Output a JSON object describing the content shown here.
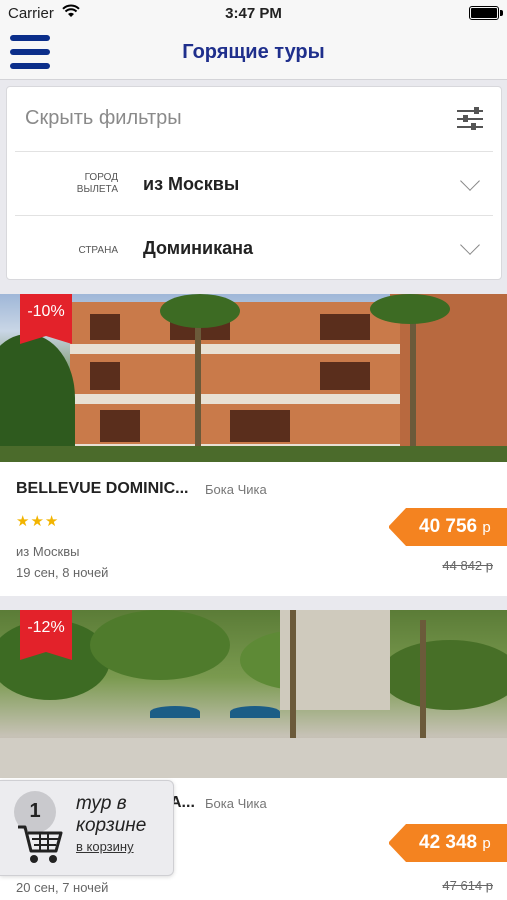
{
  "status_bar": {
    "carrier": "Carrier",
    "time": "3:47 PM"
  },
  "header": {
    "title": "Горящие туры"
  },
  "filters": {
    "hide_label": "Скрыть фильтры",
    "rows": [
      {
        "label": "Город вылета",
        "value": "из Москвы"
      },
      {
        "label": "Страна",
        "value": "Доминикана"
      }
    ]
  },
  "tours": [
    {
      "discount": "-10%",
      "hotel": "BELLEVUE DOMINIC...",
      "place": "Бока Чика",
      "stars": "★★★",
      "from": "из Москвы",
      "dates": "19 сен, 8 ночей",
      "price": "40 756",
      "currency": "р",
      "old_price": "44 842 р"
    },
    {
      "discount": "-12%",
      "hotel": "А...",
      "place": "Бока Чика",
      "dates": "20 сен, 7 ночей",
      "price": "42 348",
      "currency": "р",
      "old_price": "47 614 р"
    }
  ],
  "cart": {
    "count": "1",
    "text": "тур в корзине",
    "link": "в корзину"
  },
  "colors": {
    "brand": "#1f2f8c",
    "discount": "#e3222a",
    "price": "#f48320",
    "stars": "#f2b400"
  }
}
